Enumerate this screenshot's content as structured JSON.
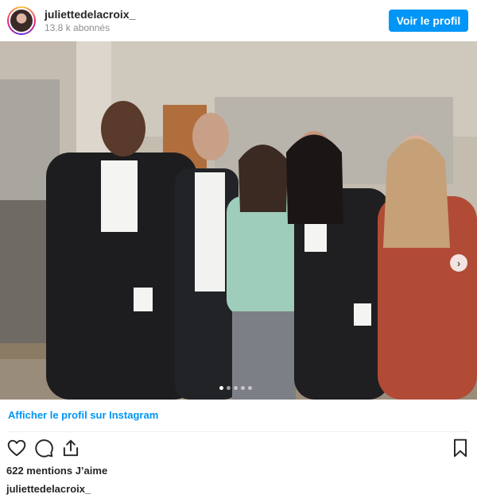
{
  "header": {
    "username": "juliettedelacroix_",
    "followers": "13.8 k abonnés",
    "profile_button": "Voir le profil"
  },
  "post": {
    "photo_alt": "Photo de groupe dans une salle d'audience",
    "carousel": {
      "total": 5,
      "active": 1
    },
    "view_profile_link": "Afficher le profil sur Instagram",
    "likes": "622 mentions J’aime",
    "caption_username": "juliettedelacroix_"
  },
  "icons": {
    "like": "heart-icon",
    "comment": "comment-icon",
    "share": "share-icon",
    "save": "bookmark-icon",
    "next": "chevron-right-icon"
  },
  "colors": {
    "accent": "#0095f6",
    "text": "#262626",
    "muted": "#8e8e8e"
  }
}
